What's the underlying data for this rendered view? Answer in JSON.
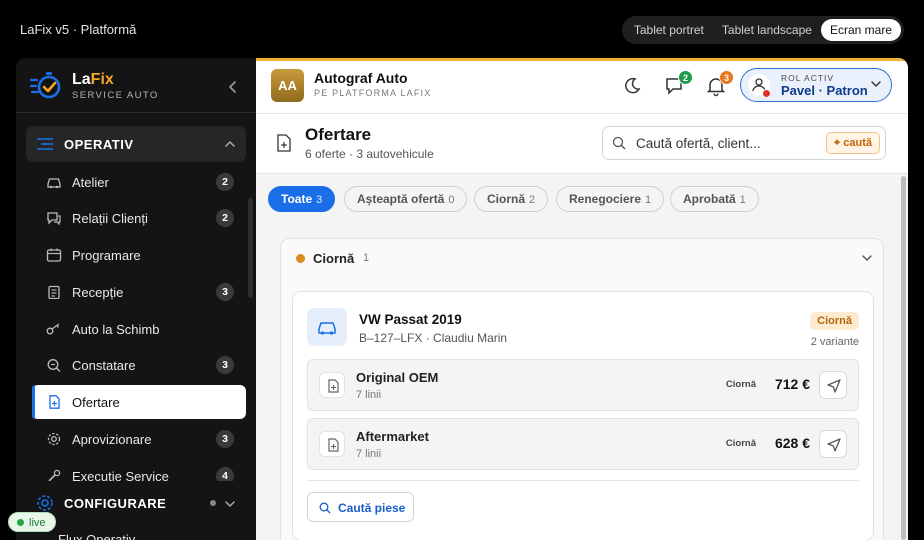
{
  "app": {
    "title": "LaFix v5 · Platformă"
  },
  "view_modes": {
    "items": [
      "Tablet portret",
      "Tablet landscape",
      "Ecran mare"
    ],
    "active": "Ecran mare"
  },
  "brand": {
    "name_prefix": "La",
    "name_suffix": "Fix",
    "subtitle": "SERVICE AUTO"
  },
  "sidebar": {
    "group_operativ": "OPERATIV",
    "items": [
      {
        "label": "Atelier",
        "badge": "2",
        "icon": "car-outline-icon"
      },
      {
        "label": "Relații Clienți",
        "badge": "2",
        "icon": "chat-icon"
      },
      {
        "label": "Programare",
        "badge": "",
        "icon": "calendar-icon"
      },
      {
        "label": "Recepție",
        "badge": "3",
        "icon": "clipboard-icon"
      },
      {
        "label": "Auto la Schimb",
        "badge": "",
        "icon": "key-icon"
      },
      {
        "label": "Constatare",
        "badge": "3",
        "icon": "search-zoom-icon"
      },
      {
        "label": "Ofertare",
        "badge": "",
        "icon": "document-add-icon",
        "active": true
      },
      {
        "label": "Aprovizionare",
        "badge": "3",
        "icon": "gear-icon"
      },
      {
        "label": "Execuție Service",
        "badge": "4",
        "icon": "wrench-icon"
      }
    ],
    "group_configurare": "CONFIGURARE",
    "next_item": "Flux Operativ",
    "live_label": "live"
  },
  "org": {
    "initials": "AA",
    "name": "Autograf Auto",
    "subtitle": "PE PLATFORMA LAFIX",
    "messages_badge": "2",
    "notifications_badge": "3",
    "role_label": "ROL ACTIV",
    "role_name": "Pavel · Patron"
  },
  "page": {
    "title": "Ofertare",
    "subtitle": "6 oferte · 3 autovehicule",
    "search_placeholder": "Caută ofertă, client...",
    "search_button": "⌖ caută"
  },
  "tabs": [
    {
      "label": "Toate",
      "count": "3",
      "active": true
    },
    {
      "label": "Așteaptă ofertă",
      "count": "0"
    },
    {
      "label": "Ciornă",
      "count": "2"
    },
    {
      "label": "Renegociere",
      "count": "1"
    },
    {
      "label": "Aprobată",
      "count": "1"
    }
  ],
  "section": {
    "title": "Ciornă",
    "count": "1",
    "card": {
      "vehicle": "VW Passat 2019",
      "details": "B–127–LFX · Claudiu Marin",
      "status": "Ciornă",
      "variants_count": "2 variante",
      "variants": [
        {
          "name": "Original OEM",
          "lines": "7 linii",
          "status": "Ciornă",
          "price": "712 €"
        },
        {
          "name": "Aftermarket",
          "lines": "7 linii",
          "status": "Ciornă",
          "price": "628 €"
        }
      ],
      "parts_button": "Caută piese"
    }
  },
  "colors": {
    "accent": "#1a6fe8",
    "brand": "#f5a623",
    "draft": "#d98b1c",
    "sidebar": "#141414"
  }
}
